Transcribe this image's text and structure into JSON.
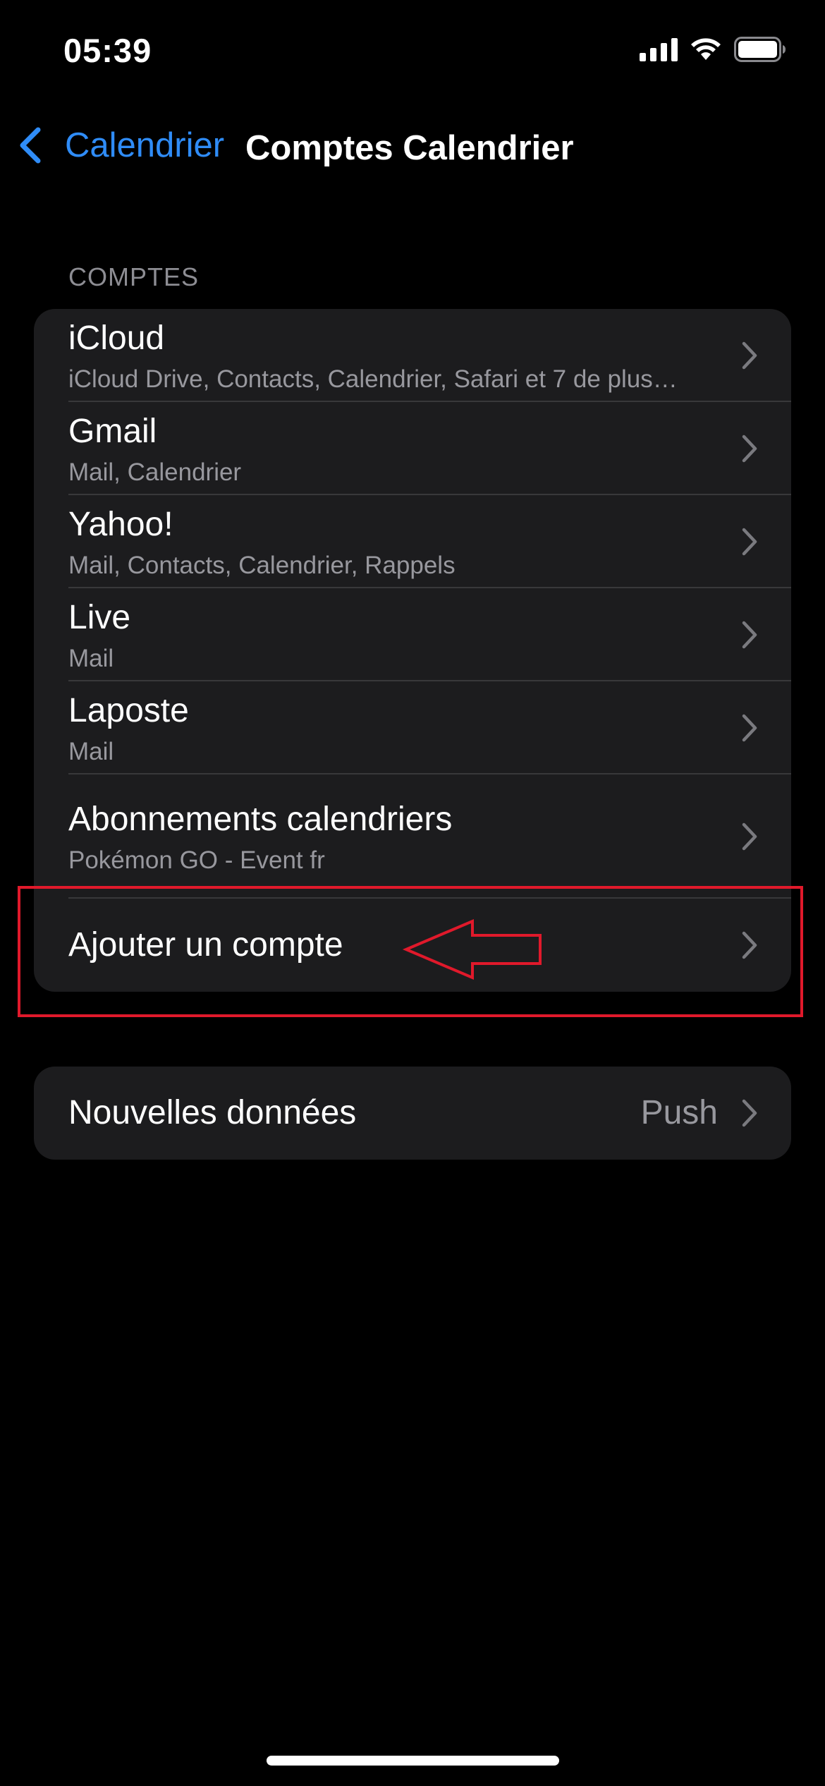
{
  "status_bar": {
    "time": "05:39",
    "icons": [
      "signal-icon",
      "wifi-icon",
      "battery-icon"
    ]
  },
  "nav": {
    "back_label": "Calendrier",
    "title": "Comptes Calendrier"
  },
  "accounts_section": {
    "header": "COMPTES",
    "rows": [
      {
        "title": "iCloud",
        "subtitle": "iCloud Drive, Contacts, Calendrier, Safari et 7 de plus…"
      },
      {
        "title": "Gmail",
        "subtitle": "Mail, Calendrier"
      },
      {
        "title": "Yahoo!",
        "subtitle": "Mail, Contacts, Calendrier, Rappels"
      },
      {
        "title": "Live",
        "subtitle": "Mail"
      },
      {
        "title": "Laposte",
        "subtitle": "Mail"
      },
      {
        "title": "Abonnements calendriers",
        "subtitle": "Pokémon GO - Event fr"
      }
    ],
    "add_account_label": "Ajouter un compte"
  },
  "fetch_section": {
    "label": "Nouvelles données",
    "value": "Push"
  },
  "colors": {
    "accent": "#2f8cf7",
    "background": "#000000",
    "cell_background": "#1c1c1e",
    "secondary_text": "#98989e",
    "annotation": "#e0192b"
  }
}
